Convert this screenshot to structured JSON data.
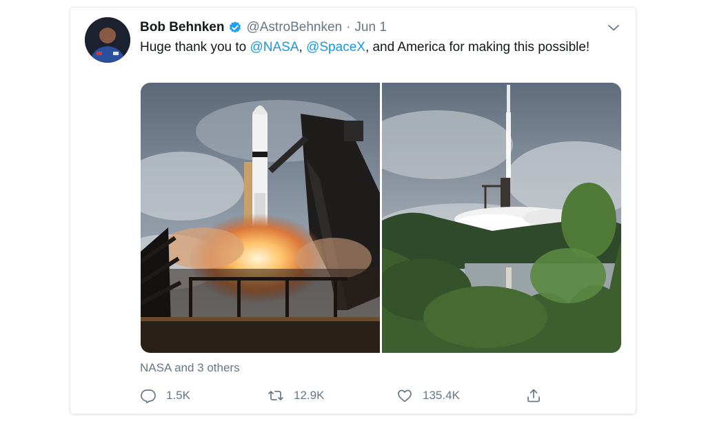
{
  "tweet": {
    "author_name": "Bob Behnken",
    "handle": "@AstroBehnken",
    "separator": "·",
    "date": "Jun 1",
    "text_parts": {
      "p1": "Huge thank you to ",
      "m1": "@NASA",
      "p2": ", ",
      "m2": "@SpaceX",
      "p3": ", and America for making this possible!"
    },
    "likers": "NASA and 3 others"
  },
  "actions": {
    "replies": "1.5K",
    "retweets": "12.9K",
    "likes": "135.4K"
  },
  "icons": {
    "verified": "verified-badge-icon",
    "more": "chevron-down-icon",
    "reply": "reply-icon",
    "retweet": "retweet-icon",
    "like": "heart-icon",
    "share": "share-icon"
  },
  "colors": {
    "accent": "#1b95e0",
    "secondary_text": "#657786",
    "primary_text": "#14171a"
  }
}
